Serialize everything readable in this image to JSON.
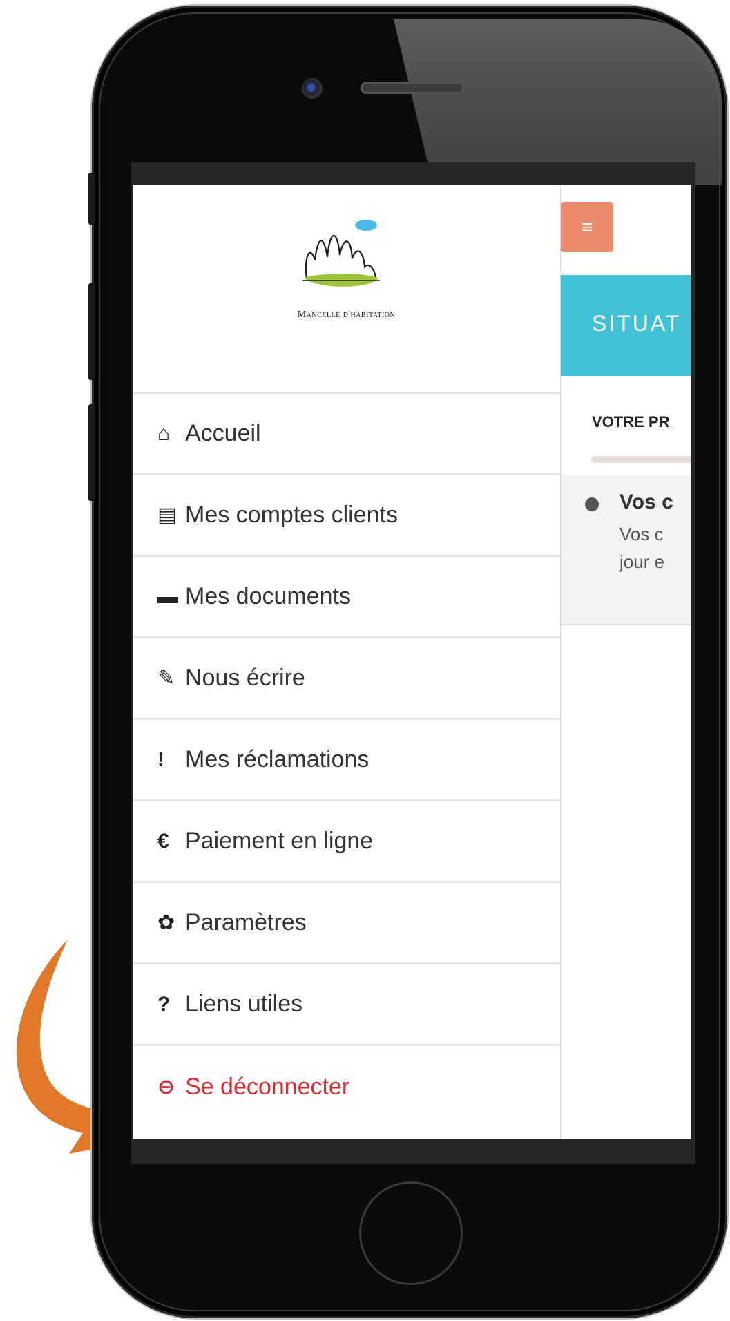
{
  "brand": {
    "logo_text": "Mancelle d'habitation"
  },
  "menu": {
    "items": [
      {
        "label": "Accueil",
        "icon": "home-icon"
      },
      {
        "label": "Mes comptes clients",
        "icon": "document-icon"
      },
      {
        "label": "Mes documents",
        "icon": "briefcase-icon"
      },
      {
        "label": "Nous écrire",
        "icon": "pencil-icon"
      },
      {
        "label": "Mes réclamations",
        "icon": "exclamation-icon"
      },
      {
        "label": "Paiement en ligne",
        "icon": "euro-icon"
      },
      {
        "label": "Paramètres",
        "icon": "gear-icon"
      },
      {
        "label": "Liens utiles",
        "icon": "question-icon"
      },
      {
        "label": "Se déconnecter",
        "icon": "logout-icon"
      }
    ],
    "icon_glyphs": [
      "⌂",
      "▤",
      "▬",
      "✎",
      "!",
      "€",
      "✿",
      "?",
      "⊖"
    ]
  },
  "main": {
    "menu_button_glyph": "≡",
    "banner_text": "SITUAT",
    "section_title": "VOTRE PR",
    "notice": {
      "title": "Vos c",
      "line1": "Vos c",
      "line2": "jour e"
    }
  },
  "colors": {
    "accent_teal": "#41c1d3",
    "menu_button": "#ec8b6e",
    "logout": "#e3262d",
    "arrow": "#e07828",
    "logo_green": "#9dc33b",
    "logo_blue": "#4db8e8"
  }
}
